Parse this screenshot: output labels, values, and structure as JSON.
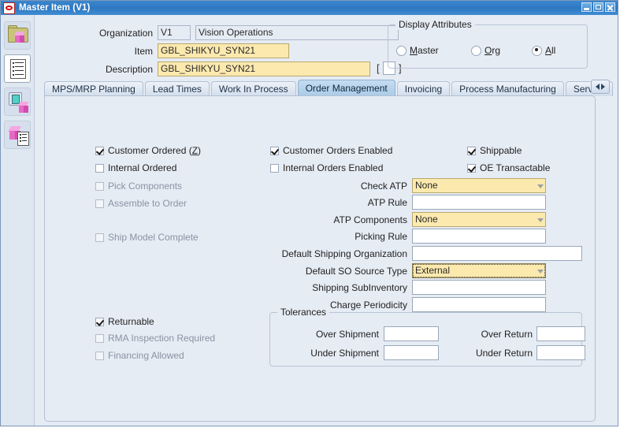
{
  "window": {
    "title": "Master Item (V1)",
    "logo_icon": "oracle-logo-icon",
    "controls": [
      {
        "name": "minimize-button",
        "icon": "minimize-icon"
      },
      {
        "name": "maximize-button",
        "icon": "maximize-icon"
      },
      {
        "name": "close-button",
        "icon": "close-icon"
      }
    ]
  },
  "toolbar": {
    "items": [
      {
        "name": "folder-cube-button",
        "icon": "folder-cube-icon"
      },
      {
        "name": "document-list-button",
        "icon": "document-list-icon"
      },
      {
        "name": "monitor-cube-button",
        "icon": "monitor-cube-icon"
      },
      {
        "name": "cube-document-button",
        "icon": "cube-document-icon"
      }
    ]
  },
  "header": {
    "organization_label": "Organization",
    "organization_code": "V1",
    "organization_name": "Vision Operations",
    "item_label": "Item",
    "item_value": "GBL_SHIKYU_SYN21",
    "description_label": "Description",
    "description_value": "GBL_SHIKYU_SYN21",
    "bracket_open": "[",
    "bracket_close": "]",
    "display_attributes": {
      "title": "Display Attributes",
      "options": [
        {
          "label": "Master",
          "mnemonic": "M",
          "rest": "aster",
          "selected": false
        },
        {
          "label": "Org",
          "mnemonic": "O",
          "rest": "rg",
          "selected": false
        },
        {
          "label": "All",
          "mnemonic": "A",
          "rest": "ll",
          "selected": true
        }
      ]
    }
  },
  "tabs": {
    "items": [
      {
        "label": "MPS/MRP Planning",
        "active": false
      },
      {
        "label": "Lead Times",
        "active": false
      },
      {
        "label": "Work In Process",
        "active": false
      },
      {
        "label": "Order Management",
        "active": true
      },
      {
        "label": "Invoicing",
        "active": false
      },
      {
        "label": "Process Manufacturing",
        "active": false
      },
      {
        "label": "Service",
        "active": false
      }
    ],
    "scroll_button": "tab-scroll-button"
  },
  "order_management": {
    "left_checkboxes": [
      {
        "label": "Customer Ordered (Z)",
        "pre": "Customer Ordered (",
        "mnemonic": "Z",
        "post": ")",
        "checked": true,
        "disabled": false
      },
      {
        "label": "Internal Ordered",
        "pre": "Internal Ordered",
        "mnemonic": "",
        "post": "",
        "checked": false,
        "disabled": false
      },
      {
        "label": "Pick Components",
        "pre": "Pick Components",
        "mnemonic": "",
        "post": "",
        "checked": false,
        "disabled": true
      },
      {
        "label": "Assemble to Order",
        "pre": "Assemble to Order",
        "mnemonic": "",
        "post": "",
        "checked": false,
        "disabled": true
      },
      {
        "label": "Ship Model Complete",
        "pre": "Ship Model Complete",
        "mnemonic": "",
        "post": "",
        "checked": false,
        "disabled": true
      }
    ],
    "middle_checkboxes": [
      {
        "label": "Customer Orders Enabled",
        "checked": true,
        "disabled": false
      },
      {
        "label": "Internal Orders Enabled",
        "checked": false,
        "disabled": false
      }
    ],
    "right_checkboxes": [
      {
        "label": "Shippable",
        "checked": true,
        "disabled": false
      },
      {
        "label": "OE Transactable",
        "checked": true,
        "disabled": false
      }
    ],
    "fields": [
      {
        "label": "Check ATP",
        "value": "None",
        "style": "required-lov",
        "focused": false
      },
      {
        "label": "ATP Rule",
        "value": "",
        "style": "normal",
        "focused": false
      },
      {
        "label": "ATP Components",
        "value": "None",
        "style": "required-lov",
        "focused": false
      },
      {
        "label": "Picking Rule",
        "value": "",
        "style": "normal",
        "focused": false
      },
      {
        "label": "Default Shipping Organization",
        "value": "",
        "style": "wide",
        "focused": false
      },
      {
        "label": "Default SO Source Type",
        "value": "External",
        "style": "required-lov",
        "focused": true
      },
      {
        "label": "Shipping SubInventory",
        "value": "",
        "style": "normal",
        "focused": false
      },
      {
        "label": "Charge Periodicity",
        "value": "",
        "style": "normal",
        "focused": false
      }
    ],
    "bottom_checkboxes": [
      {
        "label": "Returnable",
        "checked": true,
        "disabled": false
      },
      {
        "label": "RMA Inspection Required",
        "checked": false,
        "disabled": true
      },
      {
        "label": "Financing Allowed",
        "checked": false,
        "disabled": true
      }
    ],
    "tolerances": {
      "title": "Tolerances",
      "rows": [
        {
          "left_label": "Over Shipment",
          "left_value": "",
          "right_label": "Over Return",
          "right_value": ""
        },
        {
          "left_label": "Under Shipment",
          "left_value": "",
          "right_label": "Under Return",
          "right_value": ""
        }
      ]
    }
  },
  "colors": {
    "titlebar": "#2f79c2",
    "window_bg": "#e6ecf4",
    "required_field": "#fce9ae",
    "active_tab": "#a9cbe8",
    "border": "#b3c1d4"
  }
}
